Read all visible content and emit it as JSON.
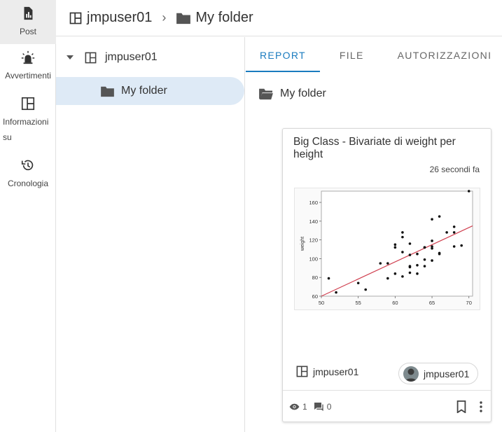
{
  "rail": {
    "items": [
      {
        "label": "Post",
        "icon": "post-icon",
        "active": true
      },
      {
        "label": "Avvertimenti",
        "icon": "alert-icon"
      },
      {
        "label": "Informazioni su",
        "icon": "info-panel-icon"
      },
      {
        "label": "Cronologia",
        "icon": "history-icon"
      }
    ]
  },
  "breadcrumb": {
    "space": "jmpuser01",
    "folder": "My folder"
  },
  "tree": {
    "root": "jmpuser01",
    "child": "My folder"
  },
  "tabs": [
    {
      "label": "REPORT"
    },
    {
      "label": "FILE"
    },
    {
      "label": "AUTORIZZAZIONI"
    }
  ],
  "folder_title": "My folder",
  "card": {
    "title": "Big Class - Bivariate di weight per height",
    "time": "26 secondi fa",
    "owner": "jmpuser01",
    "author": "jmpuser01",
    "views": "1",
    "comments": "0"
  },
  "chart_data": {
    "type": "scatter",
    "ylabel": "weight",
    "xlim": [
      50,
      70.5
    ],
    "ylim": [
      60,
      172
    ],
    "xticks": [
      50,
      55,
      60,
      65,
      70
    ],
    "yticks": [
      60,
      80,
      100,
      120,
      140,
      160
    ],
    "points": [
      [
        51,
        79
      ],
      [
        52,
        64
      ],
      [
        55,
        74
      ],
      [
        56,
        67
      ],
      [
        58,
        95
      ],
      [
        59,
        95
      ],
      [
        59,
        79
      ],
      [
        60,
        84
      ],
      [
        60,
        112
      ],
      [
        60,
        115
      ],
      [
        61,
        81
      ],
      [
        61,
        107
      ],
      [
        61,
        123
      ],
      [
        61,
        128
      ],
      [
        62,
        116
      ],
      [
        62,
        104
      ],
      [
        62,
        85
      ],
      [
        62,
        91
      ],
      [
        62,
        92
      ],
      [
        63,
        105
      ],
      [
        63,
        93
      ],
      [
        63,
        84
      ],
      [
        64,
        112
      ],
      [
        64,
        99
      ],
      [
        64,
        92
      ],
      [
        64,
        112
      ],
      [
        65,
        119
      ],
      [
        65,
        142
      ],
      [
        65,
        113
      ],
      [
        65,
        111
      ],
      [
        65,
        98
      ],
      [
        66,
        145
      ],
      [
        66,
        105
      ],
      [
        66,
        106
      ],
      [
        67,
        128
      ],
      [
        68,
        134
      ],
      [
        68,
        128
      ],
      [
        68,
        113
      ],
      [
        69,
        114
      ],
      [
        70,
        172
      ]
    ],
    "fit_line": [
      [
        50,
        60
      ],
      [
        70.5,
        135
      ]
    ],
    "colors": {
      "points": "#111111",
      "fit": "#d04050"
    }
  },
  "colors": {
    "accent": "#1a7bbf",
    "selected_bg": "#deeaf6"
  }
}
